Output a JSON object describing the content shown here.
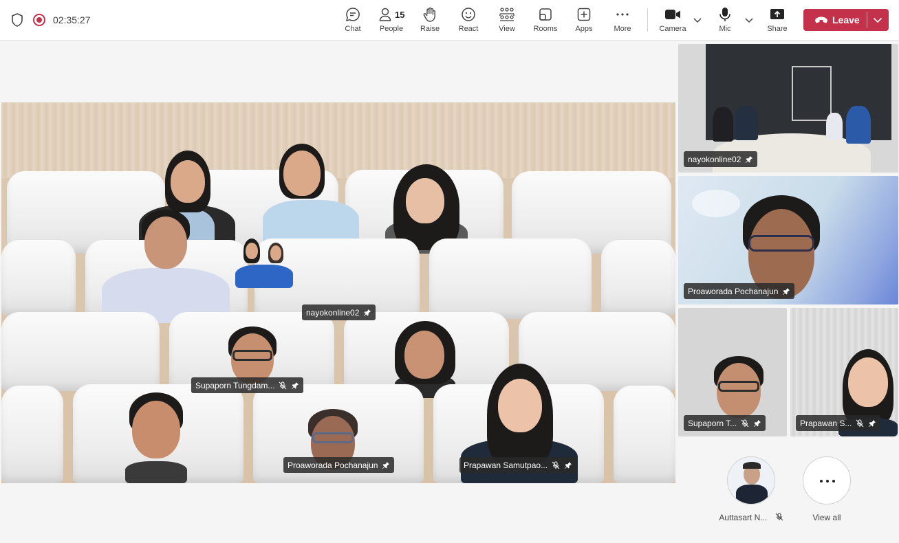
{
  "call": {
    "timer": "02:35:27"
  },
  "toolbar": {
    "chat": "Chat",
    "people": "People",
    "people_count": "15",
    "raise": "Raise",
    "react": "React",
    "view": "View",
    "rooms": "Rooms",
    "apps": "Apps",
    "more": "More",
    "camera": "Camera",
    "mic": "Mic",
    "share": "Share",
    "leave": "Leave"
  },
  "stage": {
    "tags": [
      {
        "name": "nayokonline02",
        "muted": false
      },
      {
        "name": "Supaporn Tungdam...",
        "muted": true
      },
      {
        "name": "Proaworada Pochanajun",
        "muted": false
      },
      {
        "name": "Prapawan Samutpao...",
        "muted": true
      }
    ]
  },
  "tiles": [
    {
      "name": "nayokonline02",
      "muted": false
    },
    {
      "name": "Proaworada Pochanajun",
      "muted": false
    },
    {
      "name": "Supaporn T...",
      "muted": true
    },
    {
      "name": "Prapawan S...",
      "muted": true
    }
  ],
  "roster": {
    "avatar_name": "Auttasart N...",
    "avatar_muted": true,
    "view_all": "View all"
  },
  "colors": {
    "leave": "#c4314b",
    "recording": "#c4314b"
  }
}
